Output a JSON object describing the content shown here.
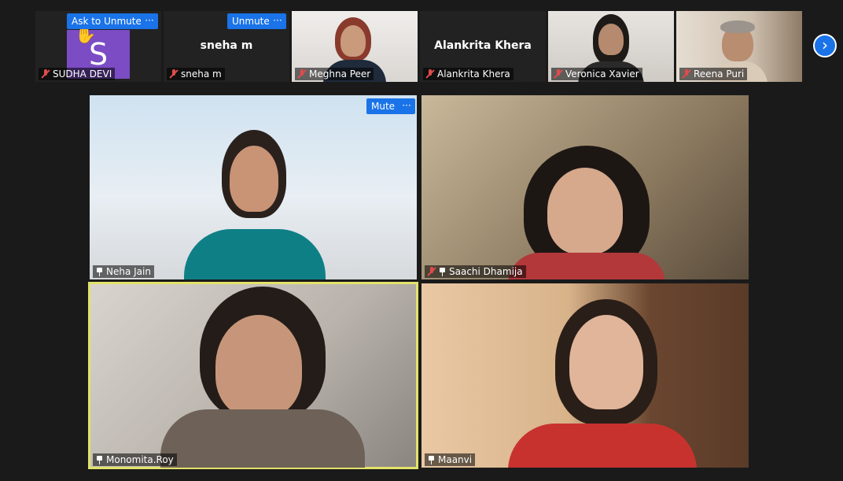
{
  "strip": {
    "tiles": [
      {
        "name": "SUDHA DEVI",
        "avatar_letter": "S",
        "button": "Ask to Unmute",
        "more": "···",
        "hand": "✋"
      },
      {
        "name": "sneha m",
        "center_name": "sneha m",
        "button": "Unmute",
        "more": "···"
      },
      {
        "name": "Meghna Peer"
      },
      {
        "name": "Alankrita Khera",
        "center_name": "Alankrita Khera"
      },
      {
        "name": "Veronica Xavier"
      },
      {
        "name": "Reena Puri"
      }
    ],
    "next_glyph": "›"
  },
  "gallery": [
    {
      "name": "Neha Jain",
      "button": "Mute",
      "more": "···"
    },
    {
      "name": "Saachi Dhamija"
    },
    {
      "name": "Monomita.Roy"
    },
    {
      "name": "Maanvi"
    }
  ],
  "colors": {
    "accent": "#1a73e8",
    "active_speaker": "#e2e26a",
    "muted_red": "#e14b4b",
    "avatar_purple": "#7b4cc4"
  }
}
